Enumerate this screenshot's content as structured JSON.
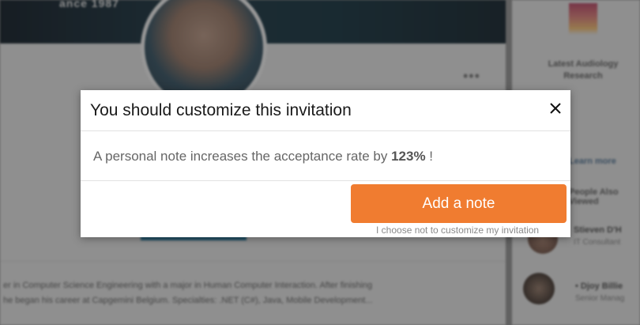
{
  "background": {
    "banner_text": "ance 1987",
    "more_label": "•••",
    "summary": "er in Computer Science Engineering with a major in Human Computer Interaction. After finishing\nhe began his career at Capgemini Belgium. Specialties: .NET (C#), Java, Mobile Development...",
    "sidebar": {
      "ad_title": "Latest Audiology\nResearch",
      "ad_more": "Learn more",
      "also_viewed": "People Also Viewed",
      "people": [
        {
          "name": "Stieven D'H",
          "title": "IT Consultant"
        },
        {
          "name": "• Djoy Billie",
          "title": "Senior Manag"
        }
      ]
    }
  },
  "modal": {
    "title": "You should customize this invitation",
    "message_prefix": "A personal note increases the acceptance rate by ",
    "message_value": "123%",
    "message_suffix": " !",
    "primary_button": "Add a note",
    "skip_link": "I choose not to customize my invitation",
    "accent_color": "#f07c30"
  },
  "icons": {
    "close": "close-icon"
  }
}
